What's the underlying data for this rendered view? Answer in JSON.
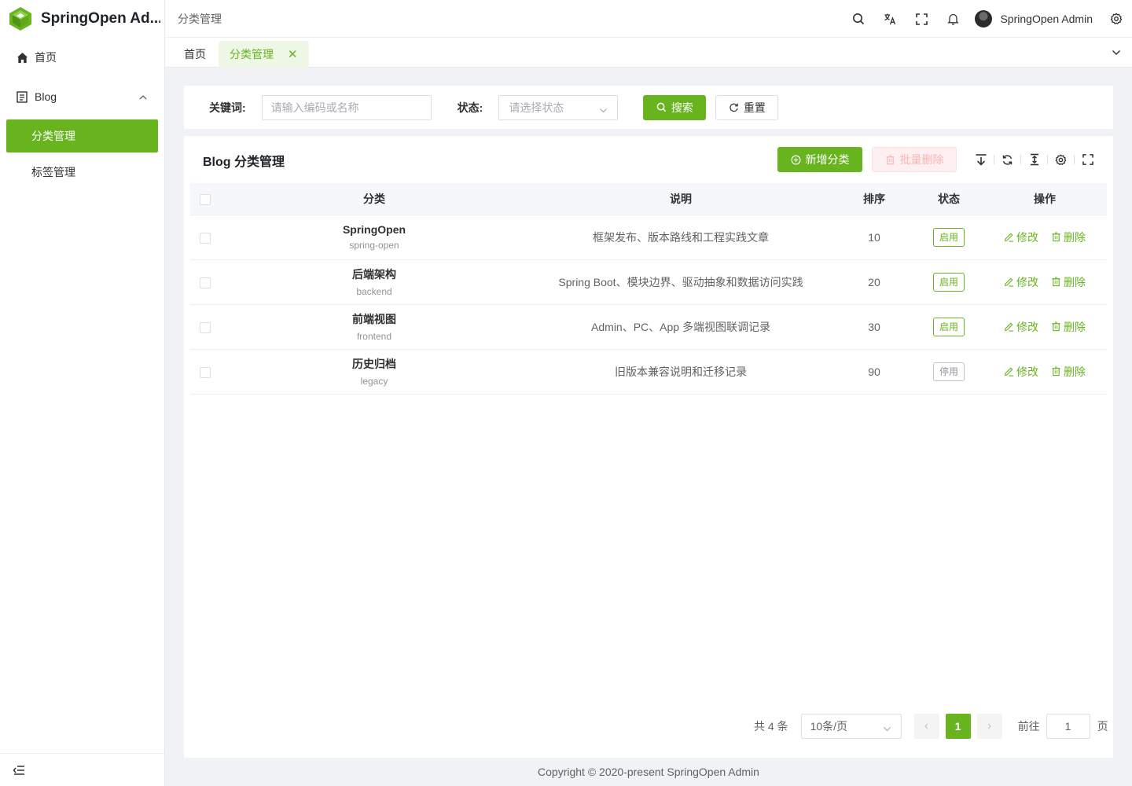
{
  "app": {
    "title": "SpringOpen Ad...",
    "brand_color": "#67b41f"
  },
  "sidebar": {
    "items": [
      {
        "label": "首页",
        "icon": "home-icon"
      },
      {
        "label": "Blog",
        "icon": "document-icon",
        "expanded": true,
        "children": [
          {
            "label": "分类管理",
            "active": true
          },
          {
            "label": "标签管理",
            "active": false
          }
        ]
      }
    ],
    "collapse_icon": "collapse-menu-icon"
  },
  "header": {
    "breadcrumb": "分类管理",
    "icons": [
      "search-icon",
      "translate-icon",
      "fullscreen-icon",
      "bell-icon",
      "settings-icon"
    ],
    "user_name": "SpringOpen Admin"
  },
  "tabs": {
    "items": [
      {
        "label": "首页",
        "active": false
      },
      {
        "label": "分类管理",
        "active": true,
        "closable": true
      }
    ],
    "close_glyph": "✕"
  },
  "search": {
    "keyword_label": "关键词:",
    "keyword_placeholder": "请输入编码或名称",
    "keyword_value": "",
    "status_label": "状态:",
    "status_placeholder": "请选择状态",
    "search_button": "搜索",
    "reset_button": "重置"
  },
  "table_card": {
    "title": "Blog 分类管理",
    "add_button": "新增分类",
    "batch_delete_button": "批量删除",
    "tool_icons": [
      "export-icon",
      "refresh-icon",
      "row-height-icon",
      "column-settings-icon",
      "fullscreen-icon"
    ],
    "columns": [
      "分类",
      "说明",
      "排序",
      "状态",
      "操作"
    ],
    "edit_label": "修改",
    "delete_label": "删除",
    "rows": [
      {
        "name": "SpringOpen",
        "code": "spring-open",
        "description": "框架发布、版本路线和工程实践文章",
        "sort": "10",
        "status": "启用",
        "enabled": true
      },
      {
        "name": "后端架构",
        "code": "backend",
        "description": "Spring Boot、模块边界、驱动抽象和数据访问实践",
        "sort": "20",
        "status": "启用",
        "enabled": true
      },
      {
        "name": "前端视图",
        "code": "frontend",
        "description": "Admin、PC、App 多端视图联调记录",
        "sort": "30",
        "status": "启用",
        "enabled": true
      },
      {
        "name": "历史归档",
        "code": "legacy",
        "description": "旧版本兼容说明和迁移记录",
        "sort": "90",
        "status": "停用",
        "enabled": false
      }
    ]
  },
  "pagination": {
    "total_text": "共 4 条",
    "page_size": "10条/页",
    "current_page": "1",
    "goto_label": "前往",
    "goto_value": "1",
    "page_suffix": "页",
    "prev_glyph": "‹",
    "next_glyph": "›"
  },
  "footer": {
    "copyright": "Copyright © 2020-present SpringOpen Admin"
  }
}
